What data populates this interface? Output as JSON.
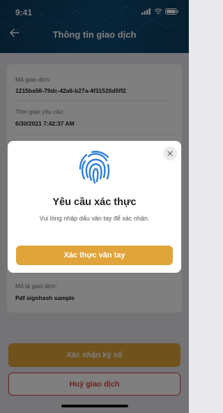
{
  "status_bar": {
    "time": "9:41"
  },
  "header": {
    "title": "Thông tin giao dịch",
    "back_icon": "arrow-left-icon"
  },
  "transaction": {
    "id_label": "Mã giao dịch:",
    "id_value": "1215ba56-79dc-42a6-b27a-4f31526d5ff2",
    "time_label": "Thời gian yêu cầu:",
    "time_value": "6/30/2021 7:42:37 AM",
    "desc_label": "Mô tả giao dịch:",
    "desc_value": "Pdf signhash sample"
  },
  "actions": {
    "confirm_label": "Xác nhận ký số",
    "cancel_label": "Huỷ giao dịch"
  },
  "modal": {
    "icon": "fingerprint-icon",
    "title": "Yêu cầu xác thực",
    "description": "Vui lòng nhập dấu vân tay để xác nhận.",
    "button_label": "Xác thực vân tay",
    "close_icon": "close-icon"
  },
  "colors": {
    "header_bg": "#0f4a73",
    "accent": "#e0a43a",
    "danger": "#d8463c",
    "fingerprint": "#2f7fd6"
  }
}
